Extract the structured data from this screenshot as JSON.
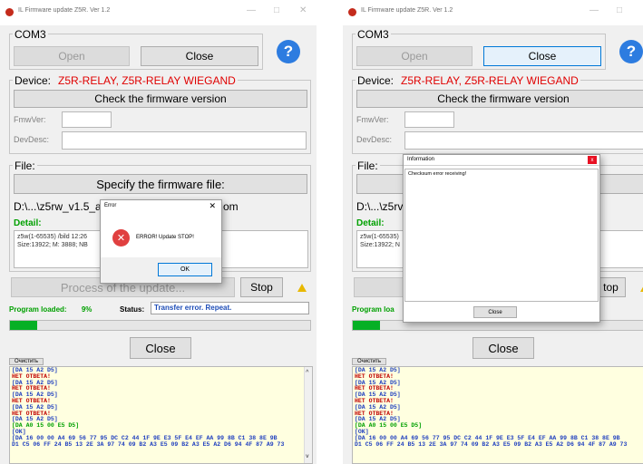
{
  "window_title": "IL Firmware update Z5R. Ver 1.2",
  "window_controls": {
    "minimize": "—",
    "maximize": "□",
    "close": "✕"
  },
  "com": {
    "port": "COM3",
    "open_label": "Open",
    "close_label": "Close",
    "help_glyph": "?"
  },
  "device": {
    "label": "Device:",
    "name": "Z5R-RELAY, Z5R-RELAY WIEGAND",
    "check_label": "Check the firmware version"
  },
  "fw": {
    "fmwver_label": "FmwVer:",
    "devdesc_label": "DevDesc:"
  },
  "file": {
    "label": "File:",
    "specify_label": "Specify the firmware file:",
    "path_left": "D:\\...\\z5rw_v1.5_a",
    "path_right": "om",
    "path_right_prefix": "D:\\...\\z5rv",
    "detail_label": "Detail:",
    "detail_line1": "z5w(1-65535) /bild 12:26",
    "detail_line2": "Size:13922; M: 3888; NB",
    "detail_line1_short": "z5w(1-65535)",
    "detail_line2_short": "Size:13922; N"
  },
  "process": {
    "label": "Process of the update...",
    "label_short": "Pro",
    "stop_label": "Stop",
    "stop_label_short": "top"
  },
  "status": {
    "loaded_label": "Program loaded:",
    "loaded_label_short": "Program loa",
    "loaded_value": "9%",
    "status_label": "Status:",
    "status_text": "Transfer error. Repeat.",
    "progress_fraction": 0.09
  },
  "bottom": {
    "close_label": "Close",
    "clear_label": "Очистить"
  },
  "log_lines": [
    {
      "text": "[DA 15 A2 D5]",
      "color": "blue"
    },
    {
      "text": "НЕТ ОТВЕТА!",
      "color": "red"
    },
    {
      "text": "[DA 15 A2 D5]",
      "color": "blue"
    },
    {
      "text": "НЕТ ОТВЕТА!",
      "color": "red"
    },
    {
      "text": "[DA 15 A2 D5]",
      "color": "blue"
    },
    {
      "text": "НЕТ ОТВЕТА!",
      "color": "red"
    },
    {
      "text": "[DA 15 A2 D5]",
      "color": "blue"
    },
    {
      "text": "НЕТ ОТВЕТА!",
      "color": "red"
    },
    {
      "text": "[DA 15 A2 D5]",
      "color": "blue"
    },
    {
      "text": "[DA A0 15 00 E5 D5]",
      "color": "green"
    },
    {
      "text": "[OK]",
      "color": "blue"
    },
    {
      "text": "[DA 16 00 00 A4 69 56 77 95 DC C2 44 1F 9E E3 5F E4 EF AA 99 8B C1 38 8E 9B",
      "color": "blue"
    },
    {
      "text": "D1 C5 06 FF 24 B5 13 2E 3A 97 74 09 B2 A3 E5 09 B2 A3 E5 A2 D6 94 4F 87 A9 73",
      "color": "blue"
    }
  ],
  "error_dialog": {
    "title": "Error",
    "close_glyph": "✕",
    "icon_glyph": "✕",
    "message": "ERROR! Update STOP!",
    "ok_label": "OK"
  },
  "info_dialog": {
    "title": "Information",
    "close_glyph": "x",
    "message": "Checksum error receiving!",
    "close_label": "Close"
  },
  "colors": {
    "device_name": "#e00000",
    "detail": "#00a000",
    "log_background": "#ffffe0",
    "progress_fill": "#06b025",
    "help_icon": "#2d7ce0"
  }
}
